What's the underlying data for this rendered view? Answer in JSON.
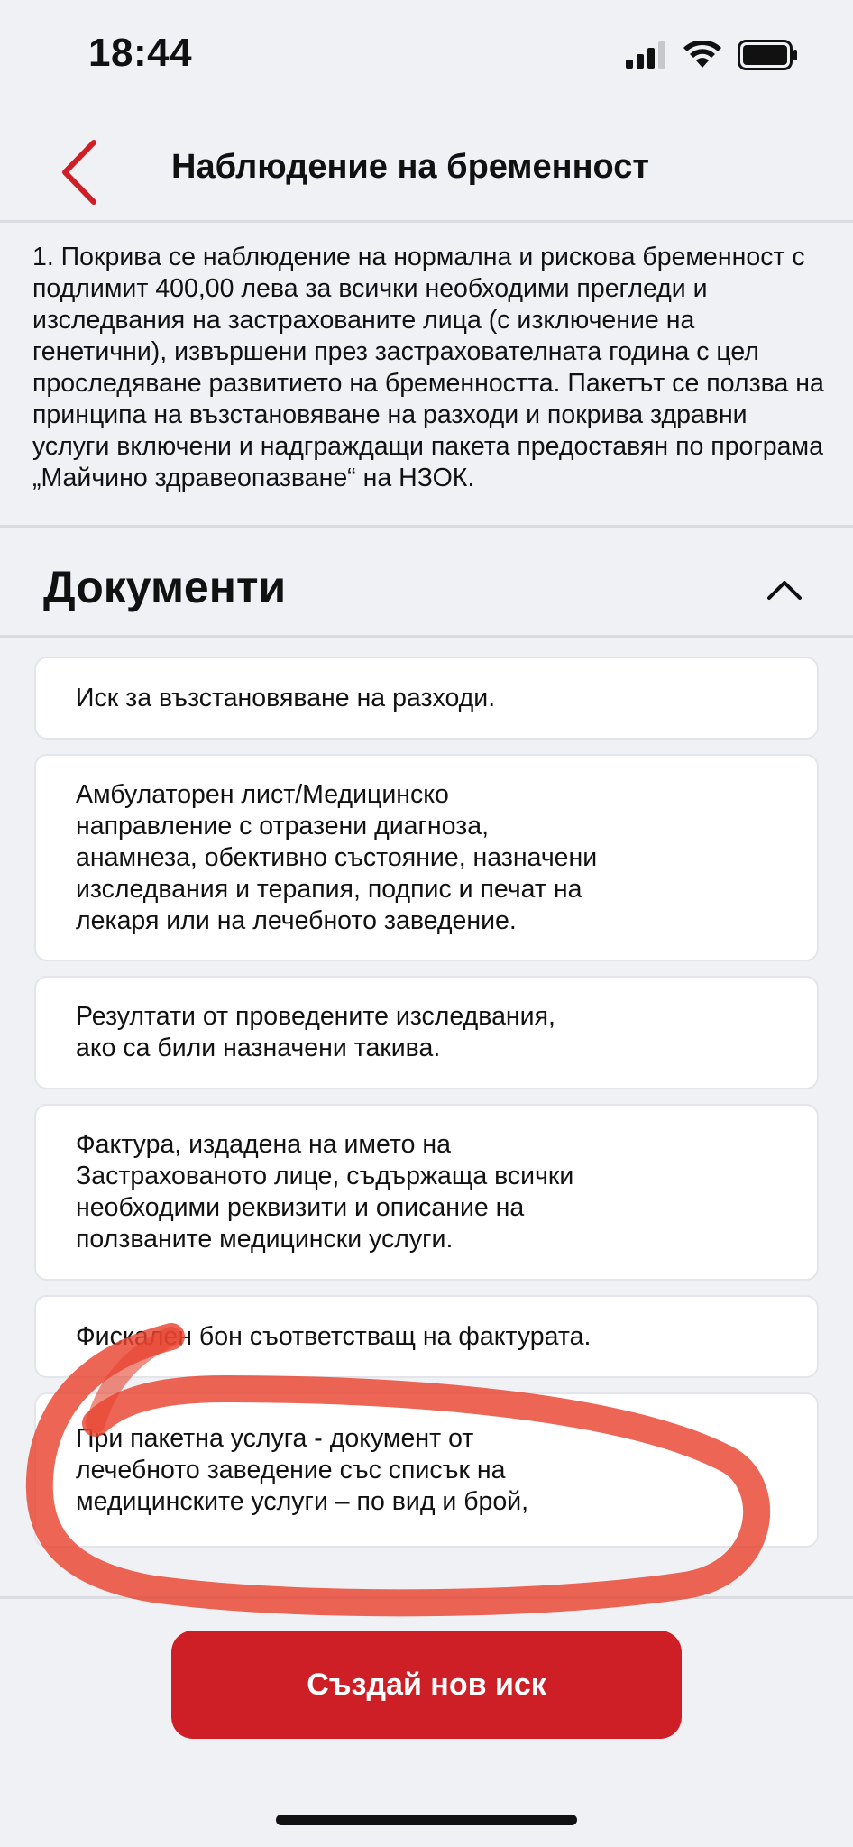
{
  "status_bar": {
    "time": "18:44"
  },
  "header": {
    "title": "Наблюдение на бременност",
    "back_icon": "chevron-left-icon"
  },
  "description": "1. Покрива се наблюдение на нормална и рискова бременност с подлимит 400,00 лева за всички необходими прегледи и изследвания на застрахованите лица (с изключение на генетични), извършени през застрахователната година с цел проследяване развитието на бременността. Пакетът се ползва на принципа на възстановяване на разходи и покрива здравни услуги включени и надграждащи пакета предоставян по програма „Майчино здравеопазване“ на НЗОК.",
  "documents": {
    "title": "Документи",
    "toggle_icon": "chevron-up-icon",
    "items": [
      {
        "text": "Иск за възстановяване на разходи."
      },
      {
        "text": "Амбулаторен лист/Медицинско\nнаправление с отразени диагноза,\nанамнеза, обективно състояние, назначени\nизследвания и терапия, подпис и печат на\nлекаря или на лечебното заведение."
      },
      {
        "text": "Резултати от проведените изследвания,\nако са били назначени такива."
      },
      {
        "text": "Фактура, издадена на името на\nЗастрахованото лице, съдържаща всички\nнеобходими реквизити и описание на\nползваните медицински услуги."
      },
      {
        "text": "Фискален бон съответстващ на фактурата."
      },
      {
        "text": "При пакетна услуга - документ от\nлечебното заведение със списък на\nмедицинските услуги – по вид и брой,"
      }
    ]
  },
  "actions": {
    "create_claim_label": "Създай нов иск"
  },
  "colors": {
    "accent": "#cf1f26",
    "background": "#f0f1f5",
    "annotation": "#e8432f"
  }
}
